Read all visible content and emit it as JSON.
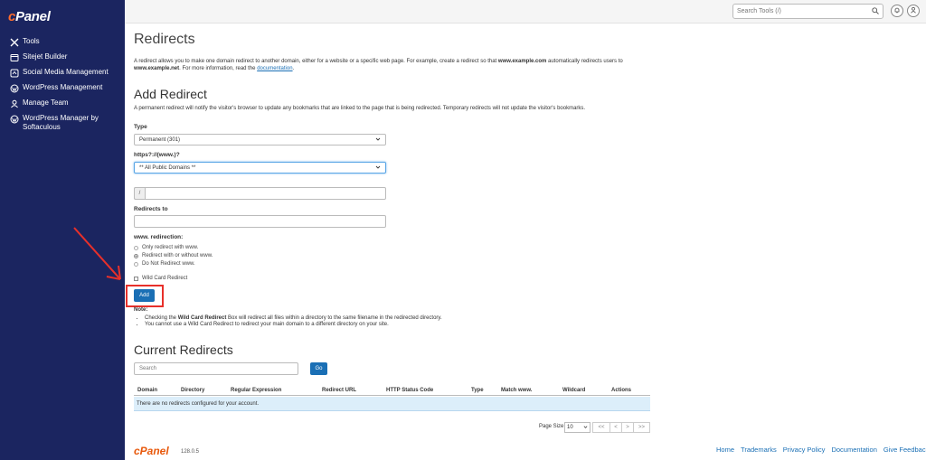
{
  "sidebar": {
    "logo": "cPanel",
    "items": [
      {
        "label": "Tools"
      },
      {
        "label": "Sitejet Builder"
      },
      {
        "label": "Social Media Management"
      },
      {
        "label": "WordPress Management"
      },
      {
        "label": "Manage Team"
      },
      {
        "label": "WordPress Manager by Softaculous"
      }
    ]
  },
  "topbar": {
    "search_placeholder": "Search Tools (/)"
  },
  "page": {
    "title": "Redirects",
    "intro_1": "A redirect allows you to make one domain redirect to another domain, either for a website or a specific web page. For example, create a redirect so that ",
    "intro_b1": "www.example.com",
    "intro_2": " automatically redirects users to ",
    "intro_b2": "www.example.net",
    "intro_3": ". For more information, read the ",
    "intro_link": "documentation",
    "intro_4": "."
  },
  "add": {
    "heading": "Add Redirect",
    "desc": "A permanent redirect will notify the visitor's browser to update any bookmarks that are linked to the page that is being redirected. Temporary redirects will not update the visitor's bookmarks.",
    "type_label": "Type",
    "type_value": "Permanent (301)",
    "domain_label": "https?://(www.)?",
    "domain_value": "** All Public Domains **",
    "path_prefix": "/",
    "redirect_to_label": "Redirects to",
    "www_label": "www. redirection:",
    "radios": [
      "Only redirect with www.",
      "Redirect with or without www.",
      "Do Not Redirect www."
    ],
    "wildcard_label": "Wild Card Redirect",
    "add_button": "Add",
    "note_label": "Note:",
    "note_1a": "Checking the ",
    "note_1b": "Wild Card Redirect",
    "note_1c": " Box will redirect all files within a directory to the same filename in the redirected directory.",
    "note_2": "You cannot use a Wild Card Redirect to redirect your main domain to a different directory on your site."
  },
  "current": {
    "heading": "Current Redirects",
    "search_placeholder": "Search",
    "go_button": "Go",
    "columns": [
      "Domain",
      "Directory",
      "Regular Expression",
      "Redirect URL",
      "HTTP Status Code",
      "Type",
      "Match www.",
      "Wildcard",
      "Actions"
    ],
    "empty_message": "There are no redirects configured for your account.",
    "page_size_label": "Page Size",
    "page_size_value": "10",
    "pager": [
      "<<",
      "<",
      ">",
      ">>"
    ]
  },
  "footer": {
    "logo": "cPanel",
    "version": "128.0.5",
    "links": [
      "Home",
      "Trademarks",
      "Privacy Policy",
      "Documentation",
      "Give Feedback"
    ]
  },
  "colors": {
    "sidebar_bg": "#1b2560",
    "primary": "#1a6fb5",
    "highlight": "#e8302a"
  }
}
